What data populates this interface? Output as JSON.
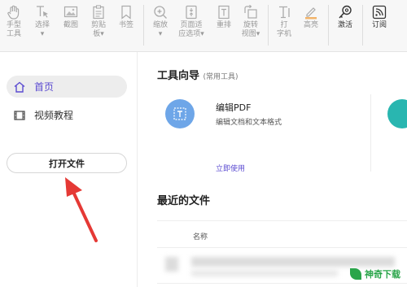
{
  "toolbar": {
    "items": [
      {
        "label": "手型\n工具",
        "icon": "hand-icon"
      },
      {
        "label": "选择\n▾",
        "icon": "select-text-icon"
      },
      {
        "label": "截图",
        "icon": "screenshot-icon"
      },
      {
        "label": "剪贴\n板▾",
        "icon": "clipboard-icon"
      },
      {
        "label": "书签",
        "icon": "bookmark-icon"
      },
      {
        "label": "缩放\n▾",
        "icon": "zoom-icon"
      },
      {
        "label": "页面适\n应选项▾",
        "icon": "fit-page-icon"
      },
      {
        "label": "重排",
        "icon": "reflow-icon"
      },
      {
        "label": "旋转\n视图▾",
        "icon": "rotate-icon"
      },
      {
        "label": "打\n字机",
        "icon": "typewriter-icon"
      },
      {
        "label": "高亮",
        "icon": "highlight-icon"
      },
      {
        "label": "激活",
        "icon": "activate-key-icon"
      },
      {
        "label": "订阅",
        "icon": "subscribe-icon"
      }
    ]
  },
  "sidebar": {
    "items": [
      {
        "label": "首页",
        "icon": "home-icon",
        "active": true
      },
      {
        "label": "视频教程",
        "icon": "video-icon",
        "active": false
      }
    ],
    "open_file_label": "打开文件"
  },
  "tool_guide": {
    "title": "工具向导",
    "subtitle": "(常用工具)",
    "card": {
      "name": "编辑PDF",
      "desc": "编辑文档和文本格式",
      "link": "立即使用",
      "icon": "edit-pdf-icon"
    }
  },
  "recent": {
    "title": "最近的文件",
    "column_name": "名称"
  },
  "watermark": {
    "text": "神奇下载"
  },
  "colors": {
    "accent": "#5b4bd1",
    "tool_icon_bg": "#6ea6e8",
    "teal": "#29b6b0",
    "arrow": "#e53935"
  }
}
